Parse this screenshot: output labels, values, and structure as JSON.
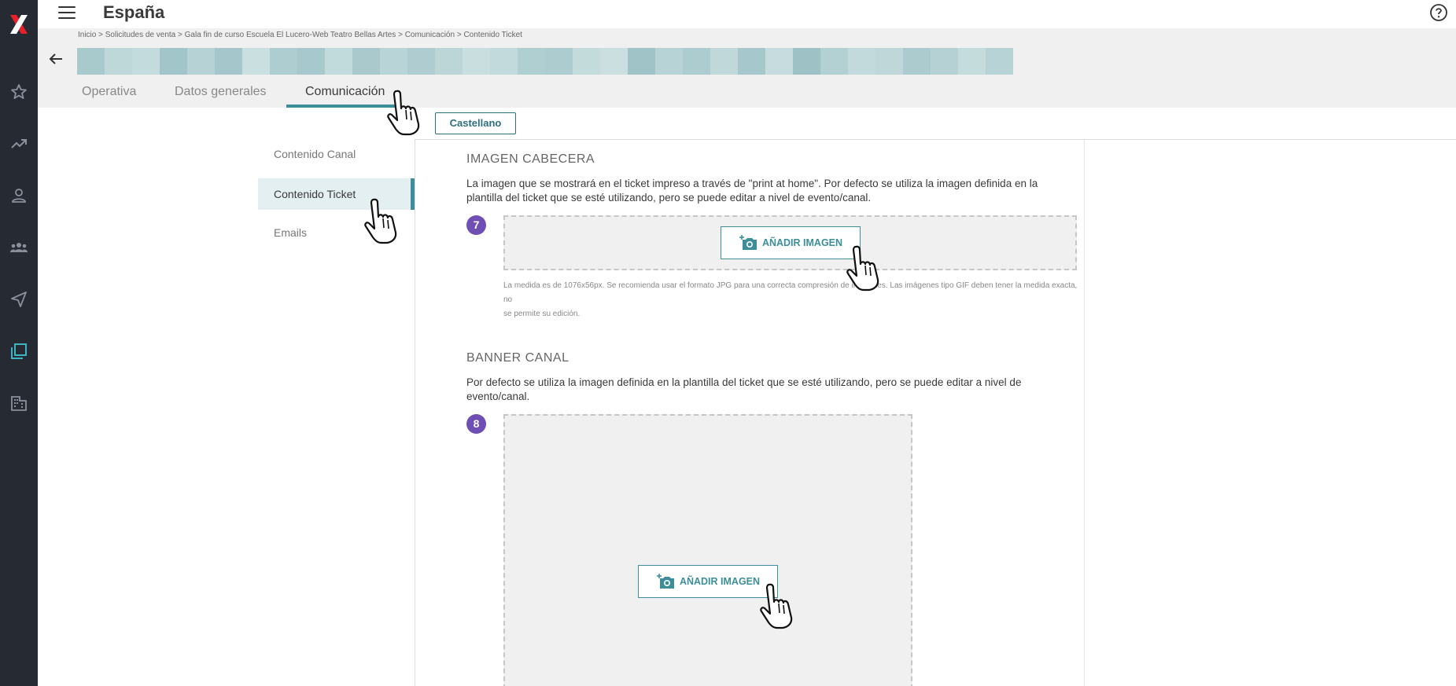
{
  "app": {
    "title": "España",
    "logo": "x-logo-icon",
    "accent_color": "#3c8e9a",
    "rail_color": "#262a33",
    "step_color": "#6f4fb4"
  },
  "rail_items": [
    {
      "name": "favorites",
      "icon": "star-icon",
      "active": false
    },
    {
      "name": "analytics",
      "icon": "trending-up-icon",
      "active": false
    },
    {
      "name": "user",
      "icon": "person-icon",
      "active": false
    },
    {
      "name": "groups",
      "icon": "group-icon",
      "active": false
    },
    {
      "name": "send",
      "icon": "send-icon",
      "active": false
    },
    {
      "name": "library",
      "icon": "library-icon",
      "active": true
    },
    {
      "name": "venues",
      "icon": "building-icon",
      "active": false
    }
  ],
  "breadcrumb": "Inicio > Solicitudes de venta > Gala fin de curso Escuela El Lucero-Web Teatro Bellas Artes > Comunicación > Contenido Ticket",
  "tabs": [
    {
      "label": "Operativa",
      "active": false
    },
    {
      "label": "Datos generales",
      "active": false
    },
    {
      "label": "Comunicación",
      "active": true
    }
  ],
  "language": {
    "selected": "Castellano"
  },
  "subnav": [
    {
      "label": "Contenido Canal",
      "active": false
    },
    {
      "label": "Contenido Ticket",
      "active": true
    },
    {
      "label": "Emails",
      "active": false
    }
  ],
  "sections": {
    "header_image": {
      "title": "IMAGEN CABECERA",
      "description": "La imagen que se mostrará en el ticket impreso a través de \"print at home\". Por defecto se utiliza la imagen definida en la plantilla del ticket que se esté utilizando, pero se puede editar a nivel de evento/canal.",
      "step": "7",
      "button_label": "AÑADIR IMAGEN",
      "hint_line1": "La medida es de 1076x56px. Se recomienda usar el formato JPG para una correcta compresión de imágenes. Las imágenes tipo GIF deben tener la medida exacta, no",
      "hint_line2": "se permite su edición."
    },
    "channel_banner": {
      "title": "BANNER CANAL",
      "description": "Por defecto se utiliza la imagen definida en la plantilla del ticket que se esté utilizando, pero se puede editar a nivel de evento/canal.",
      "step": "8",
      "button_label": "AÑADIR IMAGEN"
    }
  }
}
